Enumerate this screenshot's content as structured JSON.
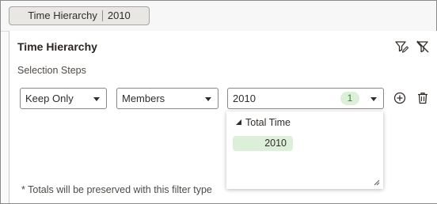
{
  "filter_chip": {
    "dimension": "Time Hierarchy",
    "value": "2010"
  },
  "panel": {
    "title": "Time Hierarchy",
    "toolbar": {
      "edit_filter_icon": "filter-edit-icon",
      "clear_filter_icon": "filter-clear-icon"
    },
    "section_label": "Selection Steps",
    "step": {
      "action": {
        "selected": "Keep Only"
      },
      "type": {
        "selected": "Members"
      },
      "members": {
        "selected": "2010",
        "count": "1"
      }
    },
    "actions": {
      "add_icon": "add-circle-icon",
      "delete_icon": "trash-icon"
    },
    "dropdown": {
      "tree_root": "Total Time",
      "selected_member": "2010"
    },
    "footnote": "* Totals will be preserved with this filter type"
  }
}
